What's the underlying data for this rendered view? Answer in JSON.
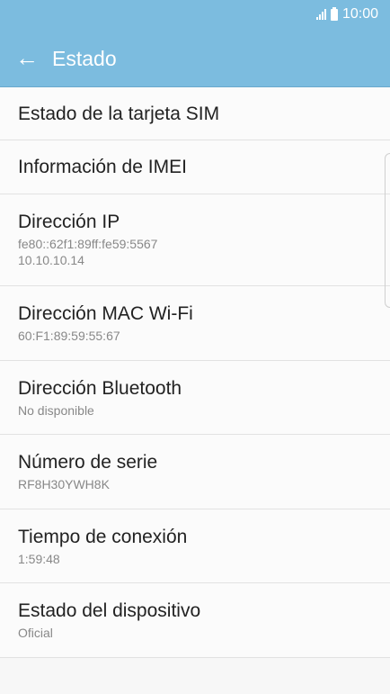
{
  "status_bar": {
    "time": "10:00",
    "icons": [
      "signal-icon",
      "battery-icon"
    ]
  },
  "app_bar": {
    "title": "Estado",
    "back_icon": "arrow-left-icon"
  },
  "items": [
    {
      "title": "Estado de la tarjeta SIM"
    },
    {
      "title": "Información de IMEI"
    },
    {
      "title": "Dirección IP",
      "sub1": "fe80::62f1:89ff:fe59:5567",
      "sub2": "10.10.10.14"
    },
    {
      "title": "Dirección MAC Wi-Fi",
      "sub1": "60:F1:89:59:55:67"
    },
    {
      "title": "Dirección Bluetooth",
      "sub1": "No disponible"
    },
    {
      "title": "Número de serie",
      "sub1": "RF8H30YWH8K"
    },
    {
      "title": "Tiempo de conexión",
      "sub1": "1:59:48"
    },
    {
      "title": "Estado del dispositivo",
      "sub1": "Oficial"
    }
  ],
  "colors": {
    "header": "#7cbcdf",
    "background": "#f7f7f7",
    "title_text": "#222222",
    "subtitle_text": "#888888"
  }
}
